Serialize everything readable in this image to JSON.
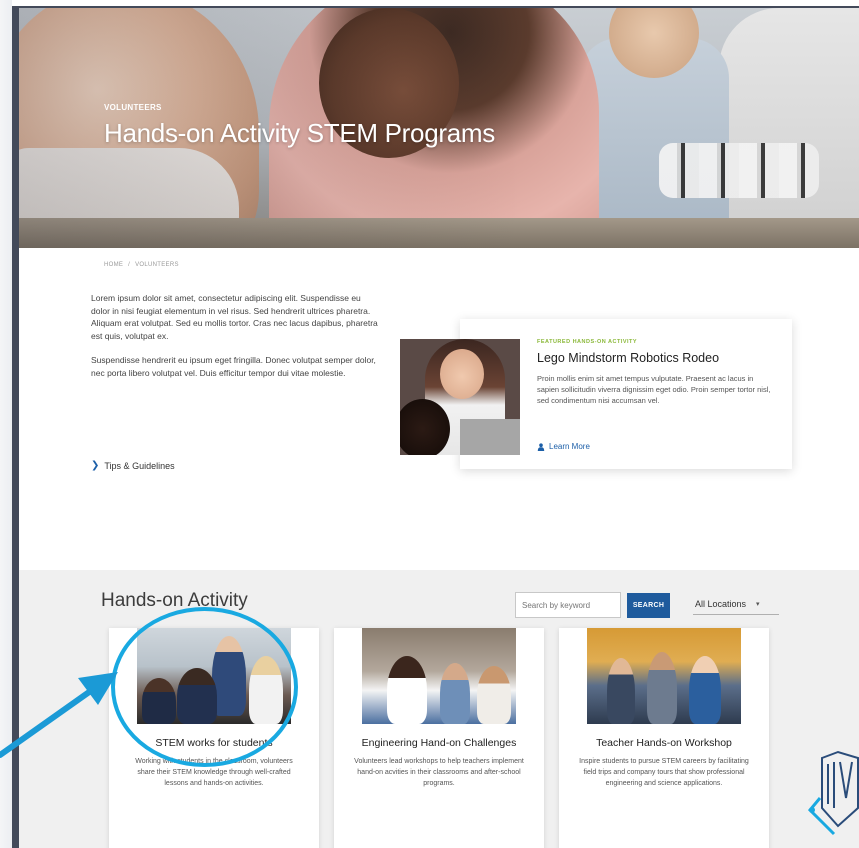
{
  "hero": {
    "eyebrow": "VOLUNTEERS",
    "title": "Hands-on Activity STEM Programs"
  },
  "breadcrumb": {
    "home": "HOME",
    "separator": "/",
    "current": "VOLUNTEERS"
  },
  "intro": {
    "paragraph_1": "Lorem ipsum dolor sit amet, consectetur adipiscing elit. Suspendisse eu dolor in nisi feugiat elementum in vel risus. Sed hendrerit ultrices pharetra. Aliquam erat volutpat. Sed eu mollis tortor. Cras nec lacus dapibus, pharetra est quis, volutpat ex.",
    "paragraph_2": "Suspendisse hendrerit eu ipsum eget fringilla. Donec volutpat semper dolor, nec porta libero volutpat vel. Duis efficitur tempor dui vitae molestie.",
    "link_label": "Tips & Guidelines",
    "link_icon": "chevron-right-icon"
  },
  "featured": {
    "eyebrow": "FEATURED HANDS-ON ACTIVITY",
    "title": "Lego Mindstorm Robotics Rodeo",
    "description": "Proin mollis enim sit amet tempus vulputate. Praesent ac lacus in sapien sollicitudin viverra dignissim eget odio. Proin semper tortor nisl, sed condimentum nisi accumsan vel.",
    "link_label": "Learn More",
    "link_icon": "person-icon"
  },
  "activity": {
    "heading": "Hands-on Activity",
    "search": {
      "placeholder": "Search by keyword",
      "button_label": "SEARCH"
    },
    "location": {
      "selected": "All Locations",
      "caret_icon": "caret-down-icon"
    },
    "cards": [
      {
        "title": "STEM works for students",
        "description": "Working with students in the classroom, volunteers share their STEM knowledge through well-crafted lessons and hands-on activities."
      },
      {
        "title": "Engineering Hand-on Challenges",
        "description": "Volunteers lead workshops to help teachers implement hand-on acvities in their classrooms and after-school programs."
      },
      {
        "title": "Teacher Hands-on Workshop",
        "description": "Inspire students to pursue STEM careers by facilitating field trips and company tours that show professional engineering and science applications."
      }
    ]
  },
  "colors": {
    "frame": "#434a5a",
    "accent_blue": "#1f5b9d",
    "eyebrow_green": "#8bb83a",
    "highlight_cyan": "#19a9e1"
  }
}
